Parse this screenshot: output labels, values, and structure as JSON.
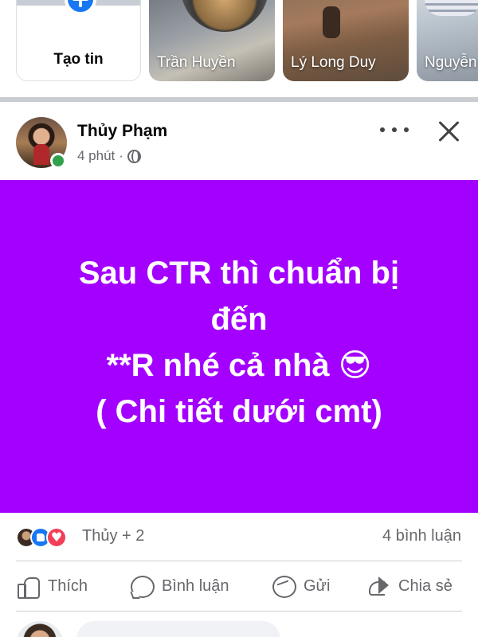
{
  "stories": {
    "create_label": "Tạo tin",
    "items": [
      {
        "name": "Trần Huyền"
      },
      {
        "name": "Lý Long Duy"
      },
      {
        "name": "Nguyễn"
      }
    ]
  },
  "post": {
    "author": "Thủy Phạm",
    "time": "4 phút",
    "separator": "·",
    "privacy_icon": "globe-icon",
    "background_color": "#a300ff",
    "text": "Sau CTR thì chuẩn bị\nđến\n**R nhé cả nhà 😎\n( Chi tiết dưới cmt)"
  },
  "reactions": {
    "names": "Thủy + 2",
    "comment_count": "4 bình luận",
    "types": [
      "like",
      "love"
    ]
  },
  "actions": {
    "like": "Thích",
    "comment": "Bình luận",
    "send": "Gửi",
    "share": "Chia sẻ"
  },
  "colors": {
    "accent": "#1877f2",
    "online": "#31a24c",
    "love": "#f33e58",
    "secondary_text": "#65676b"
  }
}
